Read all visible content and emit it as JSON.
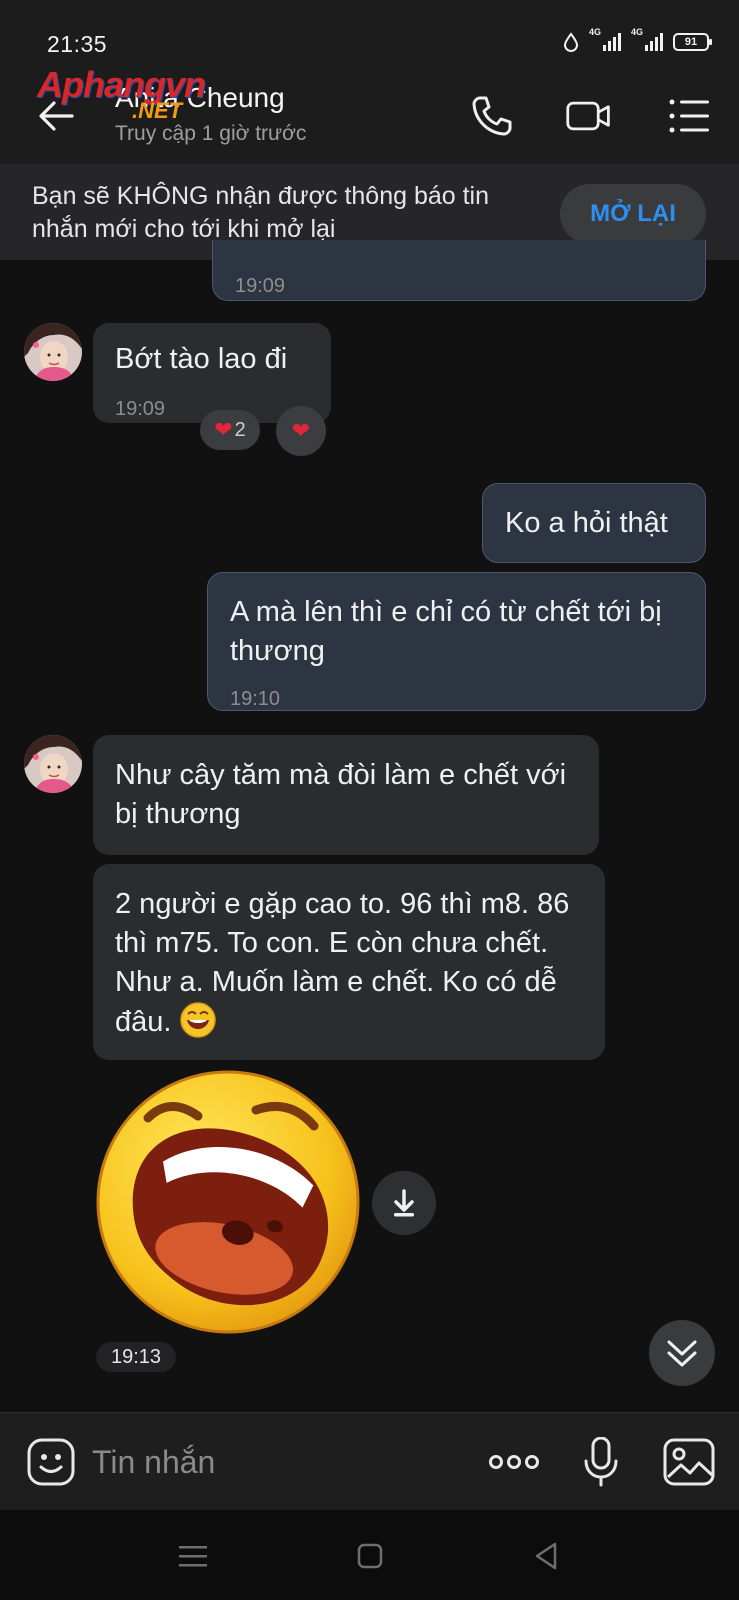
{
  "status_bar": {
    "time": "21:35",
    "network_1": "4G",
    "network_2": "4G",
    "battery": "91"
  },
  "header": {
    "contact_name": "Anita Cheung",
    "contact_status": "Truy cập 1 giờ trước",
    "watermark_main": "Aphangvn",
    "watermark_sub": ".NET"
  },
  "notice": {
    "text": "Bạn sẽ KHÔNG nhận được thông báo tin nhắn mới cho tới khi mở lại",
    "button_label": "MỞ LẠI"
  },
  "messages": [
    {
      "direction": "sent",
      "text": "",
      "time": "19:09"
    },
    {
      "direction": "received",
      "text": "Bớt tào lao đi",
      "time": "19:09",
      "reactions": [
        {
          "icon": "heart",
          "count": "2"
        },
        {
          "icon": "heart",
          "count": ""
        }
      ]
    },
    {
      "direction": "sent",
      "text": "Ko a hỏi thật",
      "time": ""
    },
    {
      "direction": "sent",
      "text": "A mà lên thì e chỉ có từ chết tới bị thương",
      "time": "19:10"
    },
    {
      "direction": "received",
      "text": "Như cây tăm mà đòi làm e chết với bị thương",
      "time": ""
    },
    {
      "direction": "received",
      "text": "2 người e gặp cao to. 96 thì m8. 86 thì m75. To con. E còn chưa chết. Như a. Muốn làm e chết. Ko có dễ đâu.",
      "emoji": "laughing-face",
      "time": ""
    },
    {
      "direction": "received",
      "type": "sticker",
      "sticker": "big-laughing-face",
      "time": "19:13"
    }
  ],
  "composer": {
    "placeholder": "Tin nhắn"
  },
  "colors": {
    "background": "#111112",
    "received_bubble": "#2b2c2e",
    "sent_bubble": "#2d3542",
    "accent": "#2f8ff0",
    "heart": "#e0263a"
  }
}
